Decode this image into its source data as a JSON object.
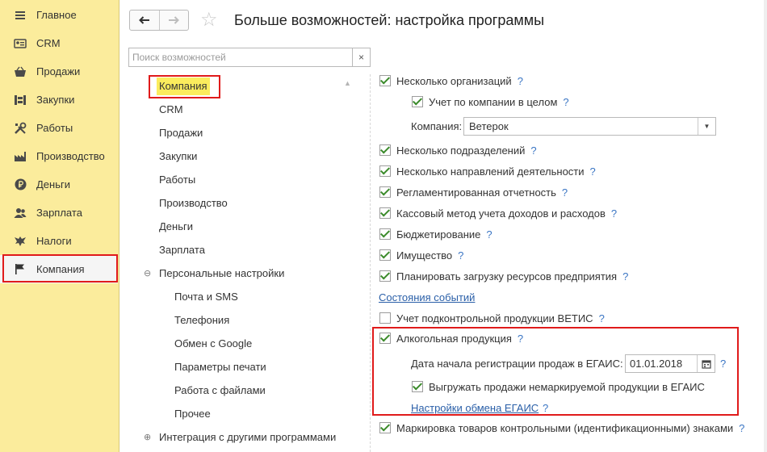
{
  "sidebar": {
    "items": [
      {
        "label": "Главное",
        "icon": "menu-icon"
      },
      {
        "label": "CRM",
        "icon": "crm-icon"
      },
      {
        "label": "Продажи",
        "icon": "basket-icon"
      },
      {
        "label": "Закупки",
        "icon": "warehouse-icon"
      },
      {
        "label": "Работы",
        "icon": "tools-icon"
      },
      {
        "label": "Производство",
        "icon": "factory-icon"
      },
      {
        "label": "Деньги",
        "icon": "ruble-icon"
      },
      {
        "label": "Зарплата",
        "icon": "people-icon"
      },
      {
        "label": "Налоги",
        "icon": "eagle-icon"
      },
      {
        "label": "Компания",
        "icon": "flag-icon",
        "active": true
      }
    ]
  },
  "header": {
    "title": "Больше возможностей: настройка программы",
    "back_icon": "arrow-left-icon",
    "forward_icon": "arrow-right-icon",
    "favorite_icon": "star-icon"
  },
  "search": {
    "placeholder": "Поиск возможностей",
    "clear_label": "×"
  },
  "tree": {
    "items": [
      {
        "label": "Компания",
        "active": true
      },
      {
        "label": "CRM"
      },
      {
        "label": "Продажи"
      },
      {
        "label": "Закупки"
      },
      {
        "label": "Работы"
      },
      {
        "label": "Производство"
      },
      {
        "label": "Деньги"
      },
      {
        "label": "Зарплата"
      },
      {
        "label": "Персональные настройки",
        "toggle": "⊖"
      },
      {
        "label": "Почта и SMS",
        "child": true
      },
      {
        "label": "Телефония",
        "child": true
      },
      {
        "label": "Обмен с Google",
        "child": true
      },
      {
        "label": "Параметры печати",
        "child": true
      },
      {
        "label": "Работа с файлами",
        "child": true
      },
      {
        "label": "Прочее",
        "child": true
      },
      {
        "label": "Интеграция с другими программами",
        "toggle": "⊕"
      }
    ]
  },
  "settings": {
    "multiple_orgs": {
      "label": "Несколько организаций",
      "checked": true
    },
    "company_accounting": {
      "label": "Учет по компании в целом",
      "checked": true
    },
    "company_field": {
      "label": "Компания:",
      "value": "Ветерок"
    },
    "multiple_departments": {
      "label": "Несколько подразделений",
      "checked": true
    },
    "multiple_directions": {
      "label": "Несколько направлений деятельности",
      "checked": true
    },
    "regulated_reporting": {
      "label": "Регламентированная отчетность",
      "checked": true
    },
    "cash_method": {
      "label": "Кассовый метод учета доходов и расходов",
      "checked": true
    },
    "budgeting": {
      "label": "Бюджетирование",
      "checked": true
    },
    "property": {
      "label": "Имущество",
      "checked": true
    },
    "resource_planning": {
      "label": "Планировать загрузку ресурсов предприятия",
      "checked": true
    },
    "events_link": "Состояния событий",
    "vetis": {
      "label": "Учет подконтрольной продукции ВЕТИС",
      "checked": false
    },
    "alcohol": {
      "label": "Алкогольная продукция",
      "checked": true
    },
    "egais_date": {
      "label": "Дата начала регистрации продаж в ЕГАИС:",
      "value": "01.01.2018"
    },
    "unmarked_sales": {
      "label": "Выгружать продажи немаркируемой продукции в ЕГАИС",
      "checked": true
    },
    "egais_link": "Настройки обмена ЕГАИС",
    "marking": {
      "label": "Маркировка товаров контрольными (идентификационными) знаками",
      "checked": true
    },
    "help_label": "?"
  },
  "colors": {
    "sidebar_bg": "#fbec9c",
    "highlight_frame": "#e01b1b",
    "active_tree_bg": "#fbec5d",
    "link": "#2a5fa8",
    "help": "#3b76c4",
    "check": "#3a8a2a"
  }
}
